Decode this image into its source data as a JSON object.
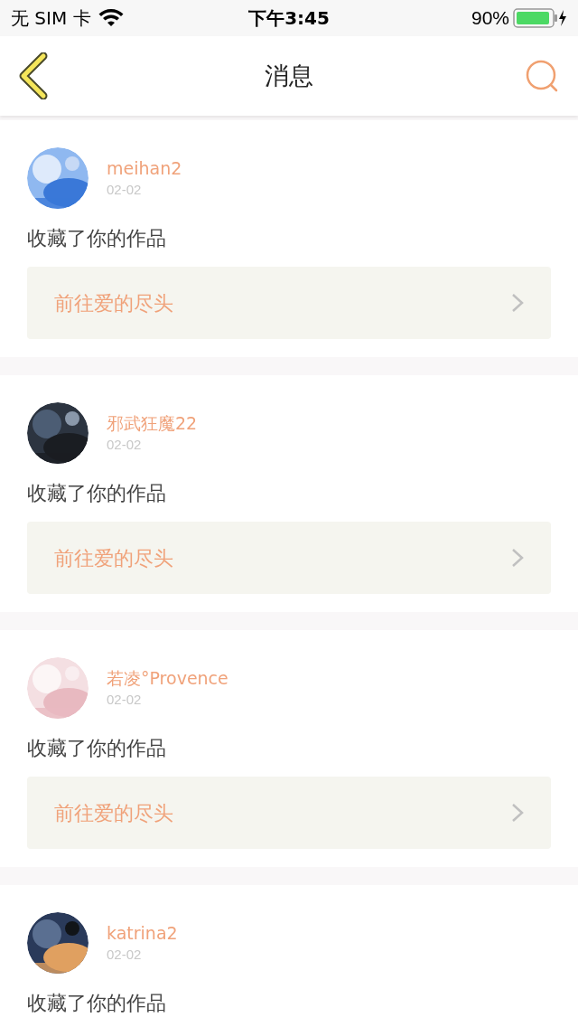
{
  "status_bar": {
    "carrier": "无 SIM 卡",
    "time": "下午3:45",
    "battery": "90%"
  },
  "nav": {
    "title": "消息"
  },
  "messages": [
    {
      "user": "meihan2",
      "date": "02-02",
      "action": "收藏了你的作品",
      "link": "前往爱的尽头"
    },
    {
      "user": "邪武狂魔22",
      "date": "02-02",
      "action": "收藏了你的作品",
      "link": "前往爱的尽头"
    },
    {
      "user": "若凌°Provence",
      "date": "02-02",
      "action": "收藏了你的作品",
      "link": "前往爱的尽头"
    },
    {
      "user": "katrina2",
      "date": "02-02",
      "action": "收藏了你的作品"
    }
  ]
}
